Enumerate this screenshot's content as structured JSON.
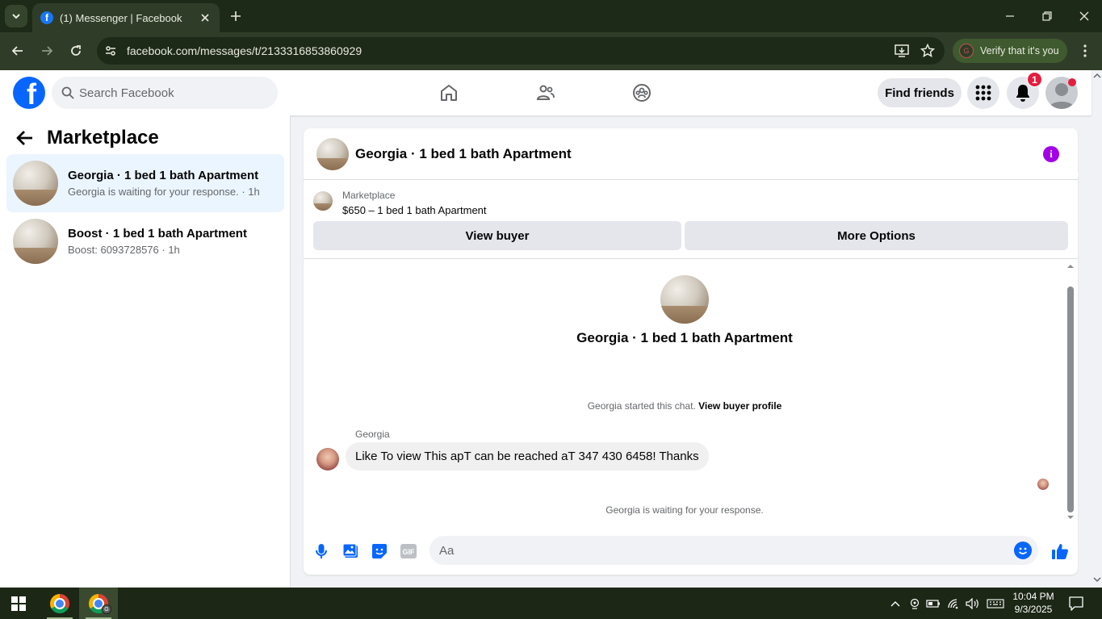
{
  "browser": {
    "tab_title": "(1) Messenger | Facebook",
    "url": "facebook.com/messages/t/2133316853860929",
    "verify_chip": "Verify that it's you",
    "verify_avatar": "G"
  },
  "fb_nav": {
    "search_placeholder": "Search Facebook",
    "find_friends": "Find friends",
    "notification_count": "1"
  },
  "sidebar": {
    "title": "Marketplace",
    "conversations": [
      {
        "name": "Georgia · 1 bed 1 bath Apartment",
        "preview": "Georgia is waiting for your response. · 1h",
        "active": true
      },
      {
        "name": "Boost · 1 bed 1 bath Apartment",
        "preview": "Boost: 6093728576 · 1h",
        "active": false
      }
    ]
  },
  "chat": {
    "title": "Georgia · 1 bed 1 bath Apartment",
    "listing_label": "Marketplace",
    "listing_price": "$650 – 1 bed 1 bath Apartment",
    "view_buyer": "View buyer",
    "more_options": "More Options",
    "center_title": "Georgia · 1 bed 1 bath Apartment",
    "started_note": "Georgia started this chat.",
    "view_buyer_profile": "View buyer profile",
    "sender": "Georgia",
    "message": "Like To view This apT can be reached aT 347 430 6458! Thanks",
    "waiting_note": "Georgia is waiting for your response.",
    "composer_placeholder": "Aa"
  },
  "taskbar": {
    "time": "10:04 PM",
    "date": "9/3/2025",
    "chrome_badge": "G"
  },
  "colors": {
    "facebook_blue": "#0866ff",
    "chrome_theme": "#2f3d28",
    "notification_red": "#e41e3f",
    "info_purple": "#a200e6"
  }
}
